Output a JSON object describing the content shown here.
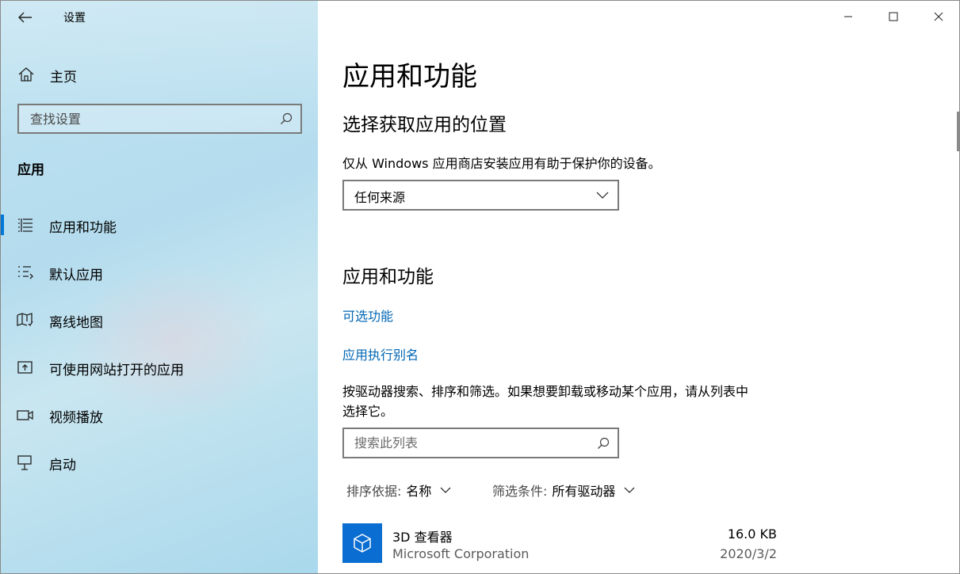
{
  "window": {
    "title": "设置"
  },
  "sidebar": {
    "home_label": "主页",
    "search_placeholder": "查找设置",
    "section": "应用",
    "items": [
      {
        "label": "应用和功能",
        "icon": "apps-list-icon",
        "active": true
      },
      {
        "label": "默认应用",
        "icon": "default-apps-icon"
      },
      {
        "label": "离线地图",
        "icon": "map-icon"
      },
      {
        "label": "可使用网站打开的应用",
        "icon": "open-web-icon"
      },
      {
        "label": "视频播放",
        "icon": "video-icon"
      },
      {
        "label": "启动",
        "icon": "startup-icon"
      }
    ]
  },
  "main": {
    "title": "应用和功能",
    "install_section": {
      "heading": "选择获取应用的位置",
      "description": "仅从 Windows 应用商店安装应用有助于保护你的设备。",
      "dropdown_value": "任何来源"
    },
    "apps_section": {
      "heading": "应用和功能",
      "link_optional": "可选功能",
      "link_alias": "应用执行别名",
      "description_line1": "按驱动器搜索、排序和筛选。如果想要卸载或移动某个应用，请从列表中",
      "description_line2": "选择它。",
      "search_placeholder": "搜索此列表",
      "sort_label": "排序依据:",
      "sort_value": "名称",
      "filter_label": "筛选条件:",
      "filter_value": "所有驱动器"
    },
    "apps": [
      {
        "name": "3D 查看器",
        "publisher": "Microsoft Corporation",
        "size": "16.0 KB",
        "date": "2020/3/2"
      }
    ]
  },
  "colors": {
    "accent": "#0078d7",
    "link": "#0066b4",
    "app_tile": "#0a6dd1"
  }
}
